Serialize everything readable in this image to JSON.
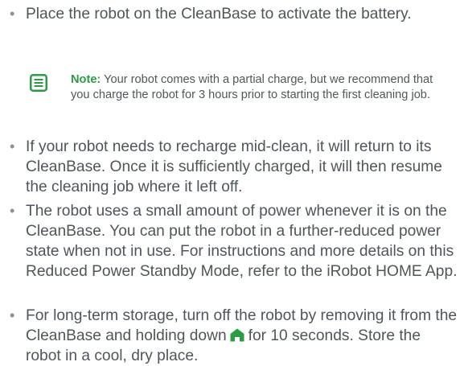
{
  "items": [
    "Place the robot on the CleanBase to activate the battery.",
    "If your robot needs to recharge mid-clean, it will return to its CleanBase. Once it is sufficiently charged, it will then resume the cleaning job where it left off.",
    "The robot uses a small amount of power whenever it is on the CleanBase. You can put the robot in a further-reduced power state when not in use. For instructions and more details on this Reduced Power Standby Mode, refer to the iRobot HOME App."
  ],
  "note": {
    "label": "Note:",
    "text": "Your robot comes with a partial charge, but we recommend that you charge the robot for 3 hours prior to starting the first cleaning job.",
    "icon": "note-icon"
  },
  "storage_item": {
    "before": "For long-term storage, turn off the robot by removing it from the CleanBase and holding down",
    "icon": "home-icon",
    "after": "for 10 seconds. Store the robot in a cool, dry place."
  },
  "colors": {
    "accent": "#2e9a45",
    "text": "#4f555b",
    "bullet": "#8a8f94"
  }
}
